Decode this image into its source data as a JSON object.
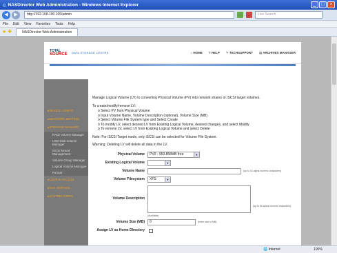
{
  "window": {
    "title": "NASDirector Web Administration - Windows Internet Explorer"
  },
  "address": {
    "url": "http://192.168.100.105/admin",
    "search_placeholder": "Live Search"
  },
  "menu": [
    "File",
    "Edit",
    "View",
    "Favorites",
    "Tools",
    "Help"
  ],
  "tab": {
    "label": "NASDirector Web Administration"
  },
  "header": {
    "logo_top": "TOTAL",
    "logo_bottom": "SOURCE",
    "subtitle": "DATA STORAGE CENTRE",
    "links": [
      "HOME",
      "HELP",
      "TECHSUPPORT",
      "ARCHIVES MANAGER"
    ]
  },
  "sidebar": {
    "items": [
      "DEVICE CONFIG",
      "NETWORK SETTING",
      "STORAGE MANAGE"
    ],
    "subitems": [
      "RAID Volume Manager",
      "USB Disk Volume Manager",
      "iSCSI Mount Management",
      "Volume Group Manager",
      "Logical Volume Manager",
      "Format"
    ],
    "items2": [
      "USER & ACCESS",
      "NAS SERVICE",
      "SYSTEM TOOLS"
    ]
  },
  "main": {
    "intro": "Manage Logical Volume (LV) to converting Physical Volume (PV) into network shares or iSCSI target volumes.",
    "howto_title": "To create/modify/remove LV:",
    "steps": [
      "Select PV from Physical Volume",
      "Input Volume Name, Volume Description (optional), Volume Size (MB)",
      "Select Volume File System type and Select Create",
      "To modify LV, select desired LV from Existing Logical Volume, desired changes, and select Modify",
      "To remove LV, select LV from Existing Logical Volume and select Delete"
    ],
    "note": "Note: For iSCSI Target mode, only iSCSI can be selected for Volume File System.",
    "warning": "Warning: Deleting LV will delete all data in the LV."
  },
  "form": {
    "physical_volume_label": "Physical Volume",
    "physical_volume_value": "PV0 - 953.858MB free",
    "existing_lv_label": "Existing Logical Volume",
    "existing_lv_value": "",
    "volume_name_label": "Volume Name",
    "volume_name_hint": "(up to 16 alpha numeric characters)",
    "filesystem_label": "Volume Filesystem",
    "filesystem_value": "XFS",
    "description_label": "Volume Description",
    "description_hint": "(up to 80 alpha numeric characters)",
    "size_caption": "(Available)",
    "size_label": "Volume Size (MB)",
    "size_value": "0",
    "size_hint": "(enter size in MB)",
    "assign_label": "Assign LV as Home Directory"
  },
  "status": {
    "zone": "Internet",
    "zoom": "100%"
  }
}
